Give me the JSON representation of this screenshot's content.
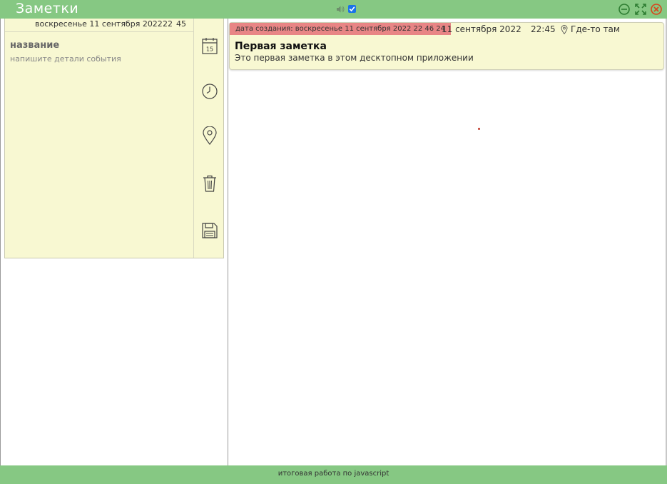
{
  "window": {
    "title": "Заметки",
    "sound_enabled": true
  },
  "editor": {
    "weekday_date": "воскресенье 11 сентября 2022",
    "hour": "22",
    "minute": "45",
    "title_placeholder": "название",
    "details_placeholder": "напишите детали события",
    "calendar_day": "15"
  },
  "notes": [
    {
      "created_label": "дата создания: воскресенье 11 сентября 2022 22 46 24",
      "date": "11 сентября 2022",
      "time": "22:45",
      "location": "Где-то там",
      "title": "Первая заметка",
      "details": "Это первая заметка в этом десктопном приложении"
    }
  ],
  "footer": {
    "text": "итоговая работа по javascript"
  },
  "colors": {
    "accent_green": "#86c883",
    "note_bg": "#f8f8d2",
    "badge_red": "#e88585"
  }
}
